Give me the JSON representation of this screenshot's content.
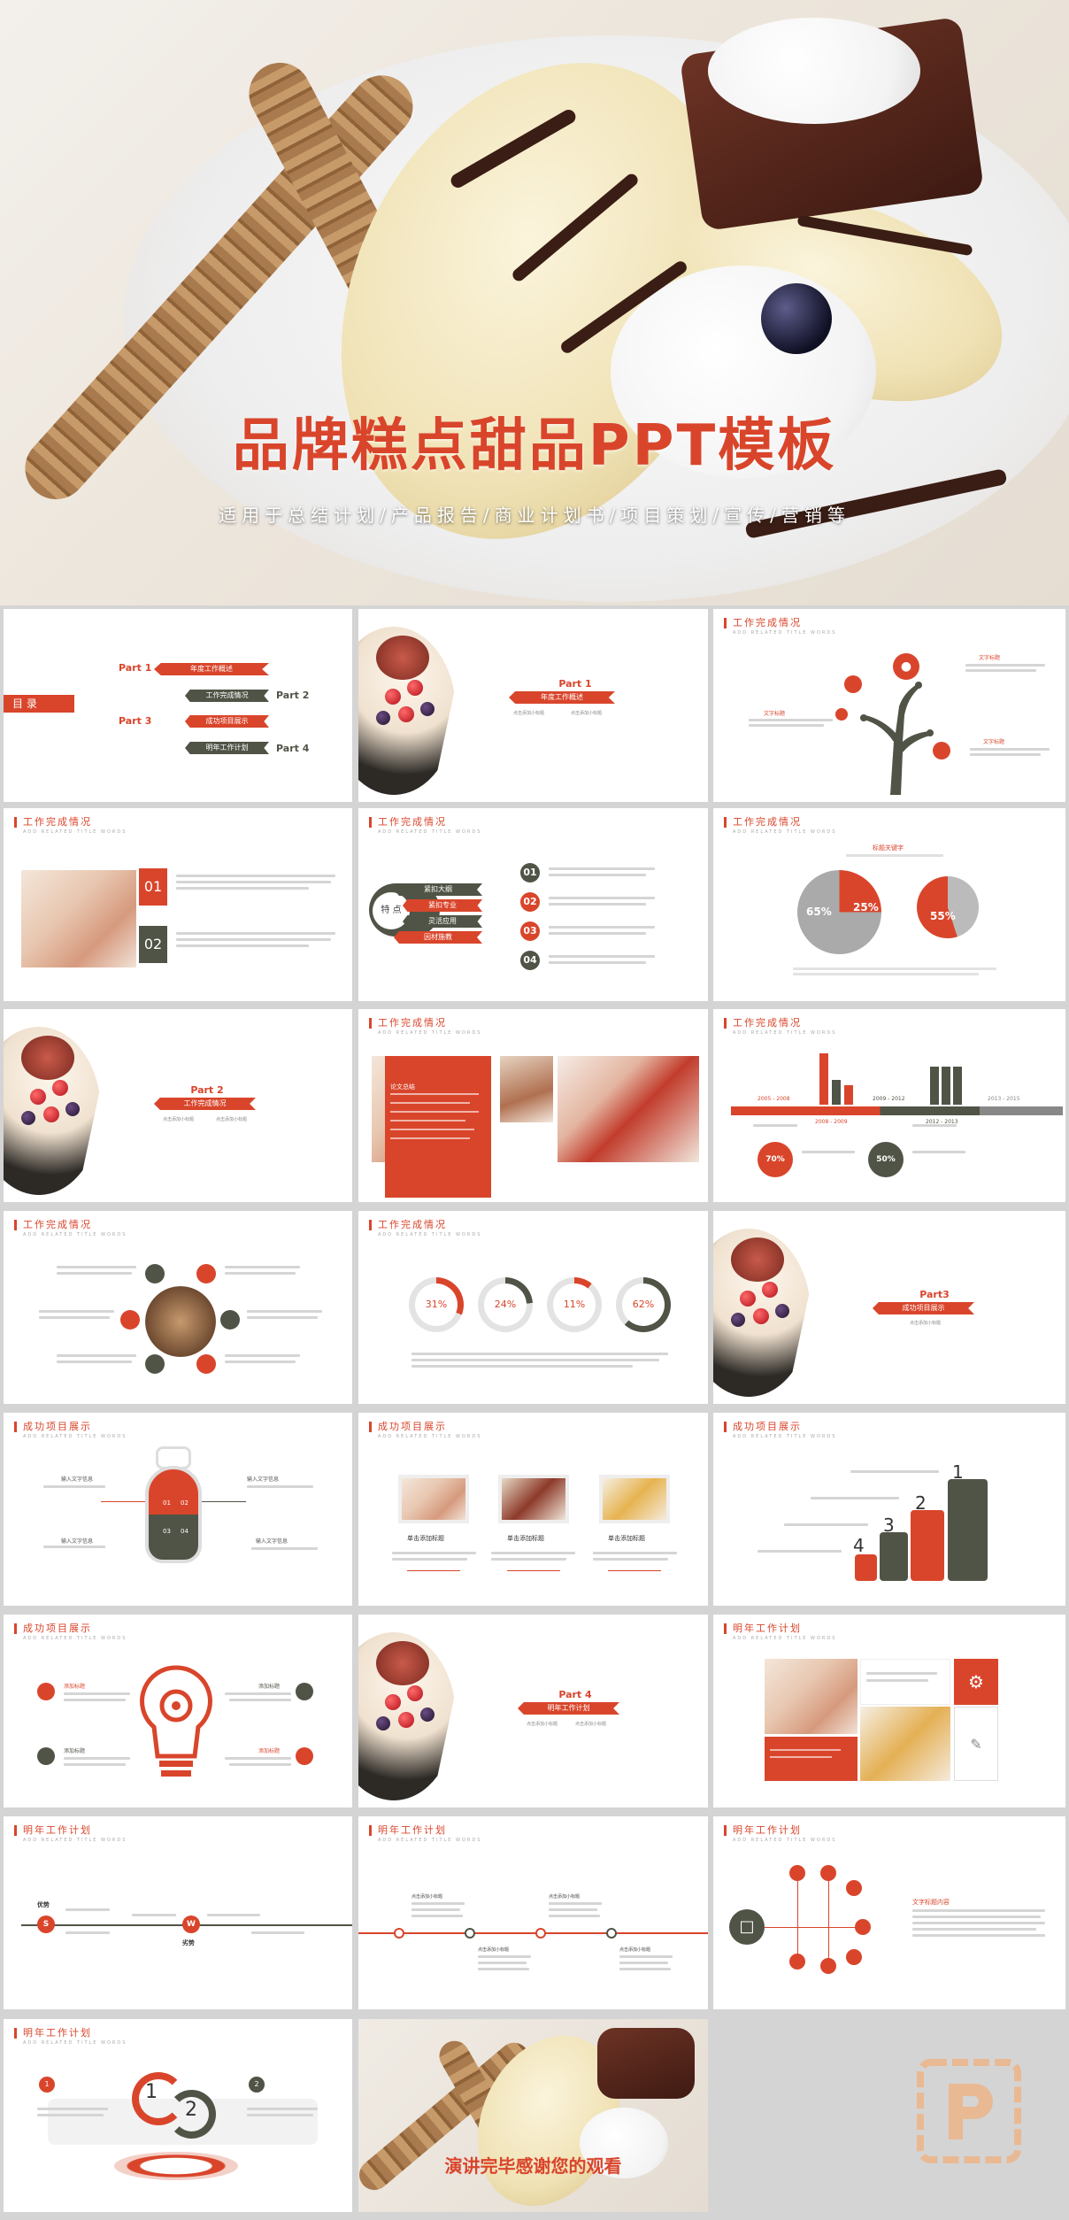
{
  "cover": {
    "title": "品牌糕点甜品PPT模板",
    "subtitle": "适用于总结计划/产品报告/商业计划书/项目策划/宣传/营销等"
  },
  "common": {
    "sub_en": "ADD RELATED TITLE WORDS",
    "work_done": "工作完成情况",
    "success": "成功项目展示",
    "next_year": "明年工作计划",
    "placeholder": "点击添加小标题"
  },
  "toc": {
    "label": "目 录",
    "items": [
      {
        "part": "Part 1",
        "text": "年度工作概述"
      },
      {
        "part": "Part 2",
        "text": "工作完成情况"
      },
      {
        "part": "Part 3",
        "text": "成功项目展示"
      },
      {
        "part": "Part 4",
        "text": "明年工作计划"
      }
    ]
  },
  "sections": [
    {
      "part": "Part 1",
      "title": "年度工作概述",
      "sub1": "点击添加小标题",
      "sub2": "点击添加小标题"
    },
    {
      "part": "Part 2",
      "title": "工作完成情况",
      "sub1": "点击添加小标题",
      "sub2": "点击添加小标题"
    },
    {
      "part": "Part3",
      "title": "成功项目展示",
      "sub1": "点击添加小标题",
      "sub2": ""
    },
    {
      "part": "Part 4",
      "title": "明年工作计划",
      "sub1": "点击添加小标题",
      "sub2": "点击添加小标题"
    }
  ],
  "tree": {
    "labels": [
      "文字标题",
      "文字标题",
      "文字标题"
    ]
  },
  "list01": {
    "nums": [
      "01",
      "02"
    ]
  },
  "features": {
    "center": "特 点",
    "tags": [
      "紧扣大纲",
      "紧扣专业",
      "灵活应用",
      "因材施教"
    ],
    "nums": [
      "01",
      "02",
      "03",
      "04"
    ]
  },
  "pie": {
    "title": "标题关键字",
    "values": [
      "65%",
      "25%",
      "55%"
    ]
  },
  "photo_text": {
    "label": "论文总结"
  },
  "timeline_bars": {
    "periods": [
      "2005 - 2008",
      "2008 - 2009",
      "2009 - 2012",
      "2012 - 2013",
      "2013 - 2015"
    ],
    "circles": [
      "70%",
      "50%"
    ]
  },
  "rings": {
    "values": [
      "31%",
      "24%",
      "11%",
      "62%"
    ]
  },
  "bulb": {
    "labels": [
      "输入文字信息",
      "输入文字信息",
      "输入文字信息",
      "输入文字信息"
    ],
    "nums": [
      "01",
      "02",
      "03",
      "04"
    ]
  },
  "three_pics": {
    "labels": [
      "单击添加标题",
      "单击添加标题",
      "单击添加标题"
    ]
  },
  "hands": {
    "nums": [
      "1",
      "2",
      "3",
      "4"
    ]
  },
  "bulb2": {
    "labels": [
      "添加标题",
      "添加标题",
      "添加标题",
      "添加标题"
    ]
  },
  "plan_swot": {
    "labels": [
      "优势",
      "劣势"
    ],
    "letters": [
      "S",
      "W"
    ]
  },
  "plan_flow": {
    "label": "文字标题内容"
  },
  "ending": {
    "title": "演讲完毕感谢您的观看"
  },
  "cycle": {
    "nums": [
      "1",
      "2"
    ]
  }
}
